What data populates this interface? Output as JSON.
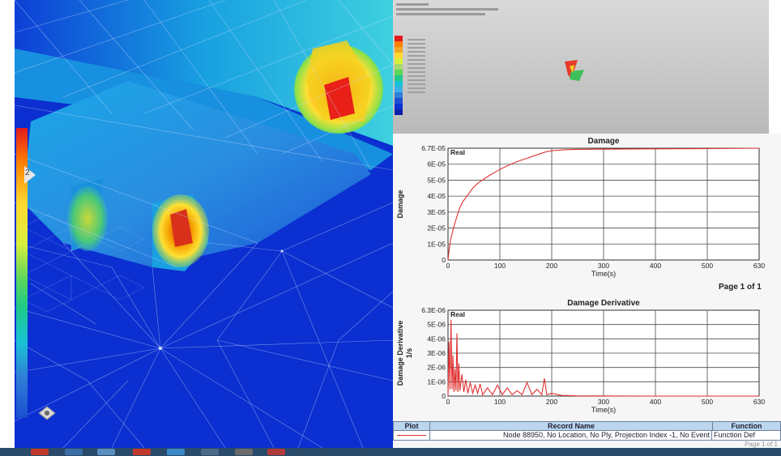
{
  "viewport": {
    "node_label": "2"
  },
  "thumbnail": {
    "legend_colors": [
      "#e31a1c",
      "#ff7f00",
      "#f5a623",
      "#ffd92f",
      "#d9ef3b",
      "#a6d96a",
      "#5bd65b",
      "#1ec989",
      "#19c2d6",
      "#3ab0e8",
      "#2f7fd6",
      "#1b4fd0",
      "#0b2fd0",
      "#0a1fa8"
    ]
  },
  "charts": {
    "damage": {
      "title": "Damage",
      "legend": "Real",
      "ylabel": "Damage",
      "xlabel": "Time(s)"
    },
    "derivative": {
      "title": "Damage Derivative",
      "legend": "Real",
      "ylabel": "Damage Derivative",
      "ylabel2": "1/s",
      "xlabel": "Time(s)"
    },
    "page_indicator": "Page 1 of 1"
  },
  "chart_data": [
    {
      "type": "line",
      "title": "Damage",
      "xlabel": "Time(s)",
      "ylabel": "Damage",
      "xlim": [
        0,
        630
      ],
      "ylim": [
        0,
        6.7e-05
      ],
      "x_ticks": [
        "0",
        "100",
        "200",
        "300",
        "400",
        "500",
        "630"
      ],
      "y_ticks": [
        "0",
        "1E-05",
        "2E-05",
        "3E-05",
        "4E-05",
        "5E-05",
        "6E-05",
        "6.7E-05"
      ],
      "series": [
        {
          "name": "Real",
          "color": "#e03030",
          "x": [
            0,
            3,
            6,
            10,
            15,
            20,
            25,
            30,
            40,
            50,
            60,
            80,
            100,
            120,
            140,
            160,
            180,
            200,
            220,
            250,
            300,
            400,
            500,
            630
          ],
          "y": [
            0,
            8e-06,
            1.3e-05,
            1.8e-05,
            2.3e-05,
            2.8e-05,
            3.2e-05,
            3.5e-05,
            3.9e-05,
            4.3e-05,
            4.6e-05,
            5e-05,
            5.35e-05,
            5.65e-05,
            5.9e-05,
            6.1e-05,
            6.3e-05,
            6.5e-05,
            6.58e-05,
            6.62e-05,
            6.64e-05,
            6.66e-05,
            6.67e-05,
            6.7e-05
          ]
        }
      ]
    },
    {
      "type": "line",
      "title": "Damage Derivative",
      "xlabel": "Time(s)",
      "ylabel": "Damage Derivative 1/s",
      "xlim": [
        0,
        630
      ],
      "ylim": [
        0,
        6.3e-06
      ],
      "x_ticks": [
        "0",
        "100",
        "200",
        "300",
        "400",
        "500",
        "630"
      ],
      "y_ticks": [
        "0",
        "1E-06",
        "2E-06",
        "3E-06",
        "4E-06",
        "5E-06",
        "6.3E-06"
      ],
      "series": [
        {
          "name": "Real",
          "color": "#e03030",
          "x": [
            0,
            2,
            4,
            6,
            8,
            10,
            12,
            14,
            16,
            18,
            20,
            22,
            24,
            28,
            32,
            36,
            40,
            45,
            50,
            55,
            60,
            65,
            70,
            80,
            90,
            100,
            110,
            120,
            130,
            140,
            150,
            160,
            170,
            180,
            190,
            195,
            200,
            210,
            230,
            260,
            300,
            400,
            630
          ],
          "y": [
            0,
            4e-06,
            5e-07,
            5.6e-06,
            5e-07,
            3e-06,
            3e-07,
            2e-06,
            4e-07,
            4.6e-06,
            3e-07,
            2.4e-06,
            4e-07,
            1.6e-06,
            3e-07,
            1.2e-06,
            2e-07,
            1e-06,
            2e-07,
            8e-07,
            2e-07,
            9e-07,
            1e-07,
            6e-07,
            1e-07,
            8e-07,
            1e-07,
            6e-07,
            1e-07,
            4e-07,
            1e-07,
            1e-06,
            1e-07,
            5e-07,
            1e-07,
            1.3e-06,
            1e-07,
            2e-07,
            5e-08,
            2e-08,
            1e-08,
            0.0,
            0.0
          ]
        }
      ]
    }
  ],
  "table": {
    "headers": [
      "Plot",
      "Record Name",
      "Function"
    ],
    "rows": [
      {
        "plot": "",
        "record": "Node 88950, No Location, No Ply, Projection Index -1, No Event",
        "function": "Function Def"
      }
    ],
    "partial_text": "Page 1 of 1"
  },
  "colors": {
    "series": "#e03030",
    "mesh_bg": "#0b2fd0",
    "table_header": "#bcd6f0"
  }
}
